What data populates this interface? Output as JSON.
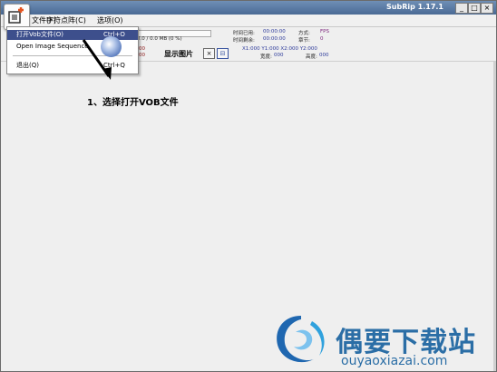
{
  "window": {
    "title": "SubRip 1.17.1",
    "min_label": "_",
    "max_label": "□",
    "close_label": "×"
  },
  "menubar": {
    "file": "文件(F)",
    "char_matrix": "字符点阵(C)",
    "options": "选项(O)"
  },
  "toolbar": {
    "mb_progress": "0.0 / 0.0 MB (0 %)",
    "elapsed_label": "时间已用:",
    "elapsed_value": "00:00:00",
    "remaining_label": "时间剩余:",
    "remaining_value": "00:00:00",
    "mode_label": "方式:",
    "mode_value": "FPS",
    "chapter_label": "章节:",
    "chapter_value": "0",
    "left_num_top": "00",
    "left_num_bottom": "00",
    "show_image": "显示图片",
    "close_btn": "×",
    "frame_btn": "⊟",
    "coords": "X1:000  Y1:000  X2:000  Y2:000",
    "width_label": "宽度:",
    "width_value": "000",
    "height_label": "高度:",
    "height_value": "000"
  },
  "file_menu": {
    "items": [
      {
        "label": "打开Vob文件(O)",
        "shortcut": "Ctrl+O",
        "selected": true
      },
      {
        "label": "Open Image Sequence",
        "shortcut": "",
        "selected": false
      },
      {
        "label": "退出(Q)",
        "shortcut": "Ctrl+Q",
        "selected": false
      }
    ]
  },
  "annotation": {
    "instruction": "1、选择打开VOB文件"
  },
  "watermark": {
    "brand_cn": "偶要下载站",
    "url": "ouyaoxiazai.com"
  },
  "colors": {
    "titlebar": "#4a6a95",
    "menu_selection": "#3d4f8c",
    "watermark": "#2b6ea6",
    "app_icon_accent": "#e5531f"
  }
}
